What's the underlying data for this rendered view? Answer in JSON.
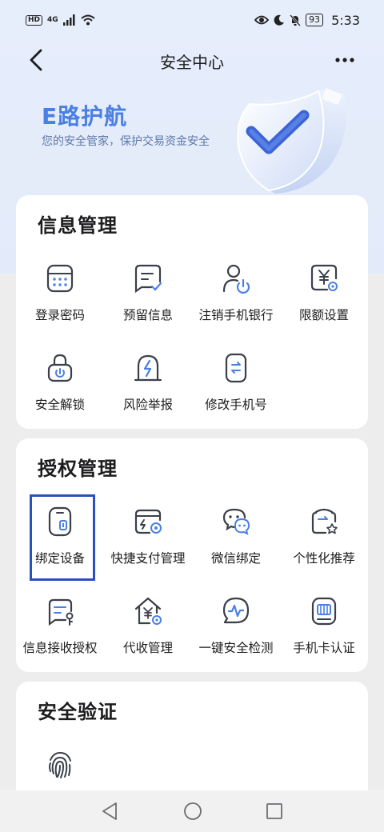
{
  "status_bar": {
    "hd": "HD",
    "network": "4G",
    "battery": "93",
    "time": "5:33"
  },
  "nav": {
    "title": "安全中心"
  },
  "hero": {
    "title": "E路护航",
    "subtitle": "您的安全管家，保护交易资金安全"
  },
  "sections": [
    {
      "title": "信息管理",
      "items": [
        {
          "label": "登录密码",
          "icon": "password-grid-icon"
        },
        {
          "label": "预留信息",
          "icon": "reserved-message-icon"
        },
        {
          "label": "注销手机银行",
          "icon": "user-power-icon"
        },
        {
          "label": "限额设置",
          "icon": "limit-yen-icon"
        },
        {
          "label": "安全解锁",
          "icon": "unlock-icon"
        },
        {
          "label": "风险举报",
          "icon": "risk-report-icon"
        },
        {
          "label": "修改手机号",
          "icon": "phone-swap-icon"
        }
      ]
    },
    {
      "title": "授权管理",
      "items": [
        {
          "label": "绑定设备",
          "icon": "bind-device-icon"
        },
        {
          "label": "快捷支付管理",
          "icon": "quick-pay-icon"
        },
        {
          "label": "微信绑定",
          "icon": "wechat-icon"
        },
        {
          "label": "个性化推荐",
          "icon": "personalized-recommend-icon"
        },
        {
          "label": "信息接收授权",
          "icon": "message-auth-icon"
        },
        {
          "label": "代收管理",
          "icon": "collection-home-icon"
        },
        {
          "label": "一键安全检测",
          "icon": "security-check-icon"
        },
        {
          "label": "手机卡认证",
          "icon": "sim-card-icon"
        }
      ]
    },
    {
      "title": "安全验证",
      "items": [
        {
          "label": "",
          "icon": "fingerprint-icon"
        }
      ]
    }
  ],
  "colors": {
    "accent": "#4a7fe4",
    "icon_stroke": "#3a3f4a",
    "highlight": "#2a4fbf"
  }
}
